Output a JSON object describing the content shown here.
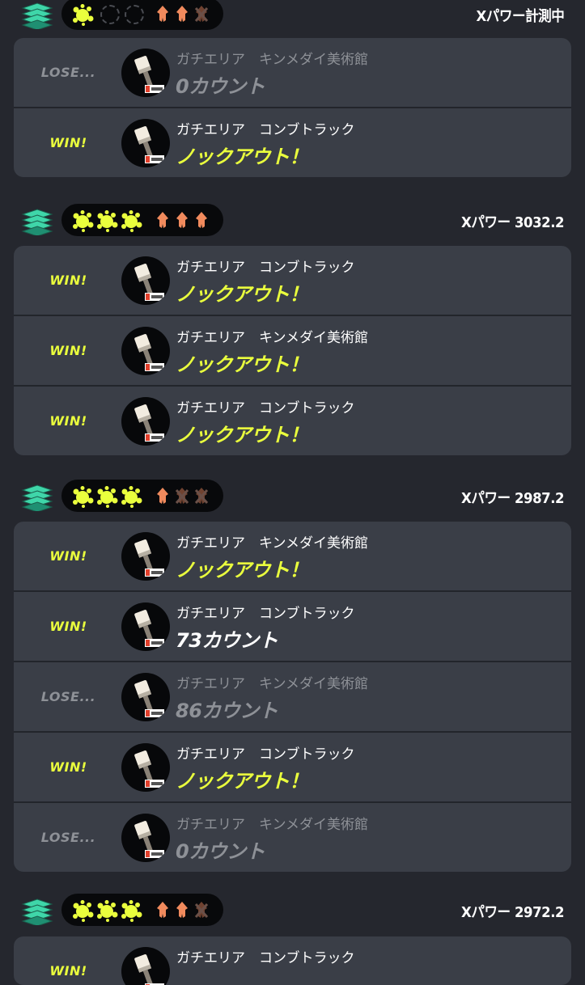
{
  "colors": {
    "background": "#25272e",
    "card": "#3a3e47",
    "win": "#eaff3d",
    "lose": "#8e9197",
    "squid": "#f08a5d",
    "rank_icon": "#3fd6a9"
  },
  "sets": [
    {
      "xpower": "Xパワー計測中",
      "progress": {
        "wins": 1,
        "losses": 1
      },
      "ink_icons": [
        "ink-splat-icon",
        "empty-slot-icon",
        "empty-slot-icon"
      ],
      "squid_icons": [
        "squid-icon",
        "squid-icon",
        "squid-crossed-icon"
      ],
      "battles": [
        {
          "result": "LOSE...",
          "mode": "ガチエリア",
          "stage": "キンメダイ美術館",
          "score": "0カウント",
          "won": false,
          "knockout": false
        },
        {
          "result": "WIN!",
          "mode": "ガチエリア",
          "stage": "コンブトラック",
          "score": "ノックアウト！",
          "won": true,
          "knockout": true
        }
      ]
    },
    {
      "xpower": "Xパワー 3032.2",
      "progress": {
        "wins": 3,
        "losses": 0
      },
      "ink_icons": [
        "ink-splat-icon",
        "ink-splat-icon",
        "ink-splat-icon"
      ],
      "squid_icons": [
        "squid-icon",
        "squid-icon",
        "squid-icon"
      ],
      "battles": [
        {
          "result": "WIN!",
          "mode": "ガチエリア",
          "stage": "コンブトラック",
          "score": "ノックアウト！",
          "won": true,
          "knockout": true
        },
        {
          "result": "WIN!",
          "mode": "ガチエリア",
          "stage": "キンメダイ美術館",
          "score": "ノックアウト！",
          "won": true,
          "knockout": true
        },
        {
          "result": "WIN!",
          "mode": "ガチエリア",
          "stage": "コンブトラック",
          "score": "ノックアウト！",
          "won": true,
          "knockout": true
        }
      ]
    },
    {
      "xpower": "Xパワー 2987.2",
      "progress": {
        "wins": 3,
        "losses": 2
      },
      "ink_icons": [
        "ink-splat-icon",
        "ink-splat-icon",
        "ink-splat-icon"
      ],
      "squid_icons": [
        "squid-icon",
        "squid-crossed-icon",
        "squid-crossed-icon"
      ],
      "battles": [
        {
          "result": "WIN!",
          "mode": "ガチエリア",
          "stage": "キンメダイ美術館",
          "score": "ノックアウト！",
          "won": true,
          "knockout": true
        },
        {
          "result": "WIN!",
          "mode": "ガチエリア",
          "stage": "コンブトラック",
          "score": "73カウント",
          "won": true,
          "knockout": false
        },
        {
          "result": "LOSE...",
          "mode": "ガチエリア",
          "stage": "キンメダイ美術館",
          "score": "86カウント",
          "won": false,
          "knockout": false
        },
        {
          "result": "WIN!",
          "mode": "ガチエリア",
          "stage": "コンブトラック",
          "score": "ノックアウト！",
          "won": true,
          "knockout": true
        },
        {
          "result": "LOSE...",
          "mode": "ガチエリア",
          "stage": "キンメダイ美術館",
          "score": "0カウント",
          "won": false,
          "knockout": false
        }
      ]
    },
    {
      "xpower": "Xパワー 2972.2",
      "progress": {
        "wins": 3,
        "losses": 1
      },
      "ink_icons": [
        "ink-splat-icon",
        "ink-splat-icon",
        "ink-splat-icon"
      ],
      "squid_icons": [
        "squid-icon",
        "squid-icon",
        "squid-crossed-icon"
      ],
      "battles": [
        {
          "result": "WIN!",
          "mode": "ガチエリア",
          "stage": "コンブトラック",
          "score": "",
          "won": true,
          "knockout": false
        }
      ]
    }
  ]
}
